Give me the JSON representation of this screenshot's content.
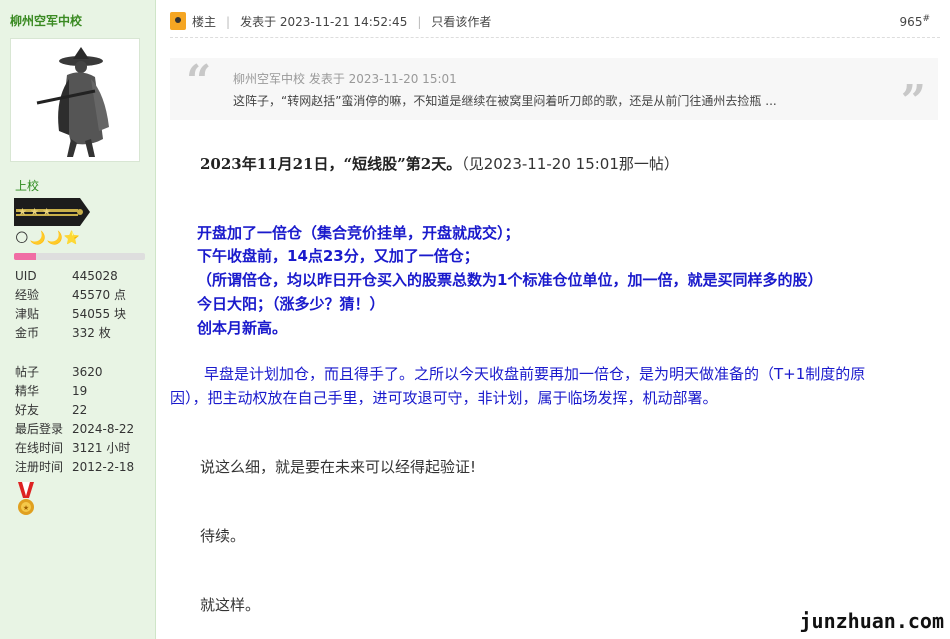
{
  "user": {
    "name": "柳州空军中校",
    "rank": "上校",
    "level_icons": "🌕🌙🌙⭐",
    "level_progress_percent": 17,
    "stats_group1": [
      {
        "key": "UID",
        "value": "445028"
      },
      {
        "key": "经验",
        "value": "45570 点"
      },
      {
        "key": "津贴",
        "value": "54055 块"
      },
      {
        "key": "金币",
        "value": "332 枚"
      }
    ],
    "stats_group2": [
      {
        "key": "帖子",
        "value": "3620"
      },
      {
        "key": "精华",
        "value": "19"
      },
      {
        "key": "好友",
        "value": "22"
      },
      {
        "key": "最后登录",
        "value": "2024-8-22"
      },
      {
        "key": "在线时间",
        "value": "3121 小时"
      },
      {
        "key": "注册时间",
        "value": "2012-2-18"
      }
    ]
  },
  "post": {
    "floor_label": "楼主",
    "posted_at": "发表于 2023-11-21 14:52:45",
    "only_author": "只看该作者",
    "floor_number": "965",
    "floor_suffix": "#",
    "quote": {
      "author": "柳州空军中校 发表于 2023-11-20 15:01",
      "text": "这阵子，“转网赵括”蛮消停的嘛，不知道是继续在被窝里闷着听刀郎的歌，还是从前门往通州去捡瓶 ..."
    },
    "heading_bold": "2023年11月21日，“短线股”第2天。",
    "heading_tail": "（见2023-11-20 15:01那一帖）",
    "blue_lines": [
      "开盘加了一倍仓（集合竞价挂单，开盘就成交）；",
      "下午收盘前，14点23分，又加了一倍仓；",
      "（所谓倍仓，均以昨日开仓买入的股票总数为1个标准仓位单位，加一倍，就是买同样多的股）",
      "今日大阳；（涨多少？猜！）",
      "创本月新高。"
    ],
    "para_line1": "早盘是计划加仓，而且得手了。之所以今天收盘前要再加一倍仓，是为明天做准备的（T+1制度的原",
    "para_line2": "因），把主动权放在自己手里，进可攻退可守，非计划，属于临场发挥，机动部署。",
    "line_detail": "说这么细，就是要在未来可以经得起验证!",
    "line_continue": "待续。",
    "line_end": "就这样。"
  },
  "watermark": "junzhuan.com"
}
